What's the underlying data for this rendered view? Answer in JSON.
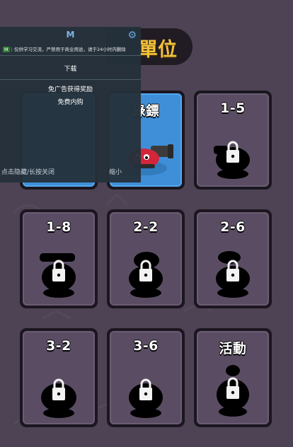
{
  "header": {
    "title": "單位"
  },
  "cards": [
    {
      "label": "",
      "state": "unlocked",
      "theme": "blue"
    },
    {
      "label": "綠鏢",
      "state": "unlocked",
      "theme": "blue"
    },
    {
      "label": "1-5",
      "state": "locked"
    },
    {
      "label": "1-8",
      "state": "locked"
    },
    {
      "label": "2-2",
      "state": "locked"
    },
    {
      "label": "2-6",
      "state": "locked"
    },
    {
      "label": "3-2",
      "state": "locked"
    },
    {
      "label": "3-6",
      "state": "locked"
    },
    {
      "label": "活動",
      "state": "locked"
    }
  ],
  "overlay": {
    "title": "M",
    "notice_tag": "M",
    "notice_text": "仅供学习交流，严禁用于商业用途，请于24小时内删除",
    "download_label": "下载",
    "ad_free_label": "免广告获得奖励",
    "free_purchase_label": "免费内购",
    "hide_hint": "点击隐藏/长按关闭",
    "minimize_label": "缩小",
    "icons": {
      "settings": "gear-icon"
    }
  },
  "colors": {
    "background": "#4d4354",
    "title": "#f4c23a",
    "card_border": "#1b1620",
    "card_fill": "#5a4d63",
    "card_unlocked": "#3f8fd8",
    "overlay": "#24313a"
  }
}
